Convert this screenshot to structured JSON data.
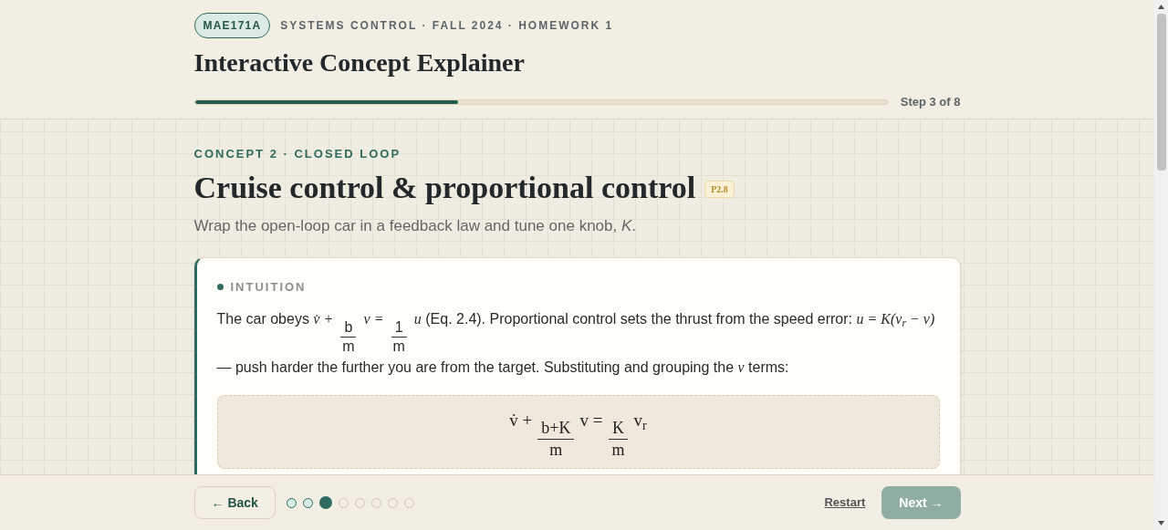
{
  "header": {
    "course_badge": "MAE171A",
    "breadcrumb": "SYSTEMS CONTROL · FALL 2024 · HOMEWORK 1",
    "title": "Interactive Concept Explainer",
    "progress": {
      "level": 0.38,
      "label": "Step 3 of 8"
    }
  },
  "concept": {
    "eyebrow": "CONCEPT 2 · CLOSED LOOP",
    "title": "Cruise control & proportional control",
    "tag": "P2.8",
    "subtitle": "Wrap the open-loop car in a feedback law and tune one knob, *K*."
  },
  "card": {
    "section_label": "INTUITION",
    "paragraph": [
      {
        "kind": "text",
        "text": "The car obeys "
      },
      {
        "kind": "math",
        "text": "v̇ +"
      },
      {
        "kind": "frac",
        "num": "b",
        "den": "m"
      },
      {
        "kind": "math",
        "text": "v ="
      },
      {
        "kind": "frac",
        "num": "1",
        "den": "m"
      },
      {
        "kind": "math",
        "text": "u"
      },
      {
        "kind": "text",
        "text": " (Eq. 2.4). Proportional control sets the thrust from the speed error: "
      },
      {
        "kind": "math",
        "text": "u = K(v$_{r}$ − v)"
      },
      {
        "kind": "text",
        "text": " — push harder the further you are from the target. Substituting and grouping the "
      },
      {
        "kind": "math",
        "text": "v"
      },
      {
        "kind": "text",
        "text": " terms:"
      }
    ],
    "equation": [
      {
        "kind": "math",
        "text": "v̇ +"
      },
      {
        "kind": "frac",
        "num": "b+K",
        "den": "m"
      },
      {
        "kind": "math",
        "text": "v ="
      },
      {
        "kind": "frac",
        "num": "K",
        "den": "m"
      },
      {
        "kind": "math",
        "text": "v$_{r}$"
      }
    ]
  },
  "footer": {
    "back": "← Back",
    "steps": [
      {
        "visited": true,
        "selected": false
      },
      {
        "visited": true,
        "selected": false
      },
      {
        "visited": true,
        "selected": true
      },
      {
        "visited": false,
        "selected": false
      },
      {
        "visited": false,
        "selected": false
      },
      {
        "visited": false,
        "selected": false
      },
      {
        "visited": false,
        "selected": false
      },
      {
        "visited": false,
        "selected": false
      }
    ],
    "restart": "Restart",
    "next": {
      "label": "Next →",
      "disabled": true
    }
  }
}
